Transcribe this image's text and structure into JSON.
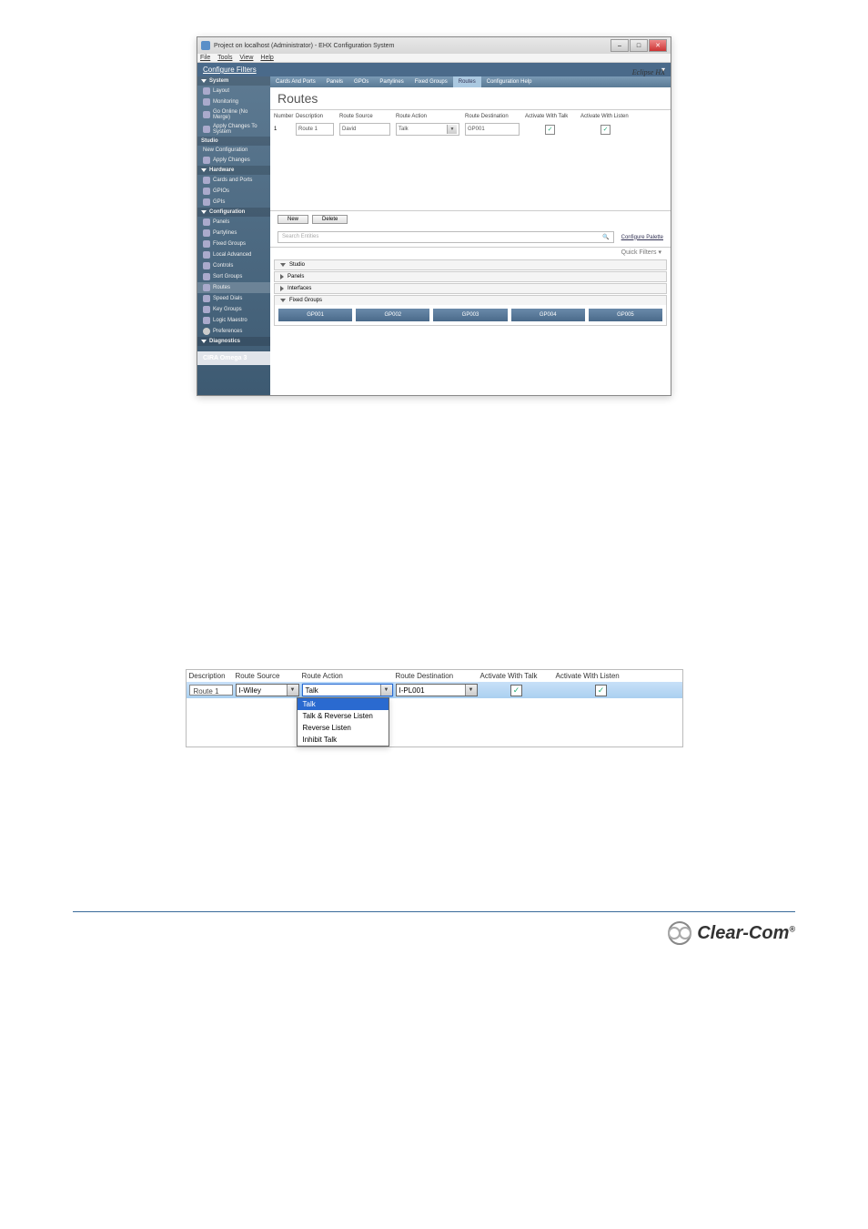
{
  "window": {
    "title": "Project on localhost (Administrator) - EHX Configuration System",
    "menubar": [
      "File",
      "Tools",
      "View",
      "Help"
    ],
    "brand": "Eclipse HX",
    "config_filter": "Configure Filters",
    "filter_symbol": "▾"
  },
  "sidebar": {
    "system": {
      "label": "System",
      "items": [
        "Layout",
        "Monitoring",
        "Go Online (No Merge)",
        "Apply Changes To System"
      ]
    },
    "studio": {
      "label": "Studio",
      "new_config": "New Configuration",
      "apply": "Apply Changes",
      "hardware": {
        "label": "Hardware",
        "items": [
          "Cards and Ports",
          "GPIOs",
          "GPIs"
        ]
      },
      "configuration": {
        "label": "Configuration",
        "items": [
          "Panels",
          "Partylines",
          "Fixed Groups",
          "Local Advanced",
          "Controls",
          "Sort Groups",
          "Routes",
          "Speed Dials",
          "Key Groups",
          "Logic Maestro",
          "Preferences"
        ],
        "selected": "Routes"
      },
      "diagnostics": {
        "label": "Diagnostics"
      }
    },
    "footer": "CIRA Omega 3"
  },
  "main": {
    "tabs": [
      "Cards And Ports",
      "Panels",
      "GPOs",
      "Partylines",
      "Fixed Groups",
      "Routes",
      "Configuration Help"
    ],
    "selected_tab": "Routes",
    "title": "Routes",
    "columns": [
      "Number",
      "Description",
      "Route Source",
      "Route Action",
      "Route Destination",
      "Activate With Talk",
      "Activate With Listen"
    ],
    "row": {
      "number": "1",
      "description": "Route 1",
      "source": "David",
      "action": "Talk",
      "destination": "GP001",
      "awt": true,
      "awl": true
    },
    "buttons": {
      "new": "New",
      "delete": "Delete"
    },
    "search_placeholder": "Search Entities",
    "configure_palette": "Configure Palette",
    "quick_filters": "Quick Filters ▾",
    "palette": {
      "sections": {
        "studio": "Studio",
        "panels": "Panels",
        "interfaces": "Interfaces",
        "fixed_groups": "Fixed Groups"
      },
      "items": [
        "GP001",
        "GP002",
        "GP003",
        "GP004",
        "GP005"
      ]
    }
  },
  "detail": {
    "columns": [
      "Description",
      "Route Source",
      "Route Action",
      "Route Destination",
      "Activate With Talk",
      "Activate With Listen"
    ],
    "description": "Route 1",
    "source": "I-Wiley",
    "action": "Talk",
    "destination": "I-PL001",
    "awt": true,
    "awl": true,
    "dropdown": [
      "Talk",
      "Talk & Reverse Listen",
      "Reverse Listen",
      "Inhibit Talk"
    ],
    "dropdown_selected": "Talk"
  },
  "footer_logo": "Clear-Com"
}
